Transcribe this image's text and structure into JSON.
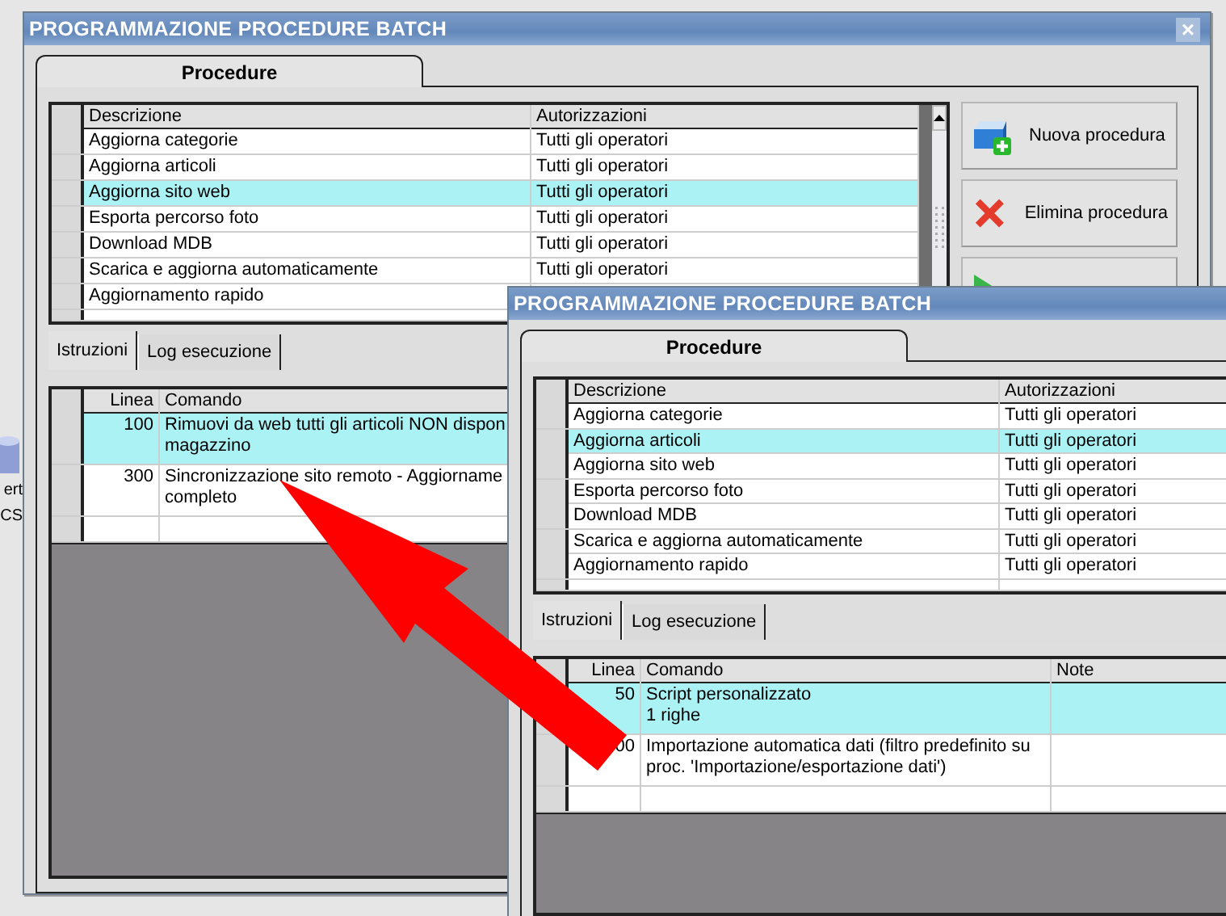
{
  "desktop": {
    "icon_labels": [
      "ert",
      "CS"
    ]
  },
  "back_window": {
    "title": "PROGRAMMAZIONE PROCEDURE BATCH",
    "close": "×",
    "tabs": [
      {
        "label": "Procedure",
        "selected": true
      }
    ],
    "procedures": {
      "columns": [
        "Descrizione",
        "Autorizzazioni"
      ],
      "rows": [
        {
          "descrizione": "Aggiorna categorie",
          "autorizzazioni": "Tutti gli operatori",
          "selected": false
        },
        {
          "descrizione": "Aggiorna articoli",
          "autorizzazioni": "Tutti gli operatori",
          "selected": false
        },
        {
          "descrizione": "Aggiorna sito web",
          "autorizzazioni": "Tutti gli operatori",
          "selected": true
        },
        {
          "descrizione": "Esporta percorso foto",
          "autorizzazioni": "Tutti gli operatori",
          "selected": false
        },
        {
          "descrizione": "Download MDB",
          "autorizzazioni": "Tutti gli operatori",
          "selected": false
        },
        {
          "descrizione": "Scarica e aggiorna automaticamente",
          "autorizzazioni": "Tutti gli operatori",
          "selected": false
        },
        {
          "descrizione": "Aggiornamento rapido",
          "selected": false
        }
      ]
    },
    "buttons": [
      {
        "kind": "new",
        "label": "Nuova procedura"
      },
      {
        "kind": "delete",
        "label": "Elimina procedura"
      },
      {
        "kind": "run"
      }
    ],
    "instruction_tabs": [
      {
        "label": "Istruzioni",
        "selected": true
      },
      {
        "label": "Log esecuzione",
        "selected": false
      }
    ],
    "instructions": {
      "columns": [
        "Linea",
        "Comando"
      ],
      "rows": [
        {
          "linea": "100",
          "comando": [
            "Rimuovi da web tutti gli articoli NON dispon",
            "magazzino"
          ],
          "selected": true
        },
        {
          "linea": "300",
          "comando": [
            "Sincronizzazione sito remoto - Aggiorname",
            "completo"
          ],
          "selected": false
        }
      ]
    }
  },
  "front_window": {
    "title": "PROGRAMMAZIONE PROCEDURE BATCH",
    "tabs": [
      {
        "label": "Procedure",
        "selected": true
      }
    ],
    "procedures": {
      "columns": [
        "Descrizione",
        "Autorizzazioni"
      ],
      "rows": [
        {
          "descrizione": "Aggiorna categorie",
          "autorizzazioni": "Tutti gli operatori",
          "selected": false
        },
        {
          "descrizione": "Aggiorna articoli",
          "autorizzazioni": "Tutti gli operatori",
          "selected": true
        },
        {
          "descrizione": "Aggiorna sito web",
          "autorizzazioni": "Tutti gli operatori",
          "selected": false
        },
        {
          "descrizione": "Esporta percorso foto",
          "autorizzazioni": "Tutti gli operatori",
          "selected": false
        },
        {
          "descrizione": "Download MDB",
          "autorizzazioni": "Tutti gli operatori",
          "selected": false
        },
        {
          "descrizione": "Scarica e aggiorna automaticamente",
          "autorizzazioni": "Tutti gli operatori",
          "selected": false
        },
        {
          "descrizione": "Aggiornamento rapido",
          "autorizzazioni": "Tutti gli operatori",
          "selected": false
        }
      ]
    },
    "instruction_tabs": [
      {
        "label": "Istruzioni",
        "selected": true
      },
      {
        "label": "Log esecuzione",
        "selected": false
      }
    ],
    "instructions": {
      "columns": [
        "Linea",
        "Comando",
        "Note"
      ],
      "rows": [
        {
          "linea": "50",
          "comando": [
            "Script personalizzato",
            "1 righe"
          ],
          "selected": true
        },
        {
          "linea": "00",
          "comando": [
            "Importazione automatica dati (filtro predefinito su",
            "proc. 'Importazione/esportazione dati')"
          ],
          "selected": false
        }
      ]
    }
  }
}
